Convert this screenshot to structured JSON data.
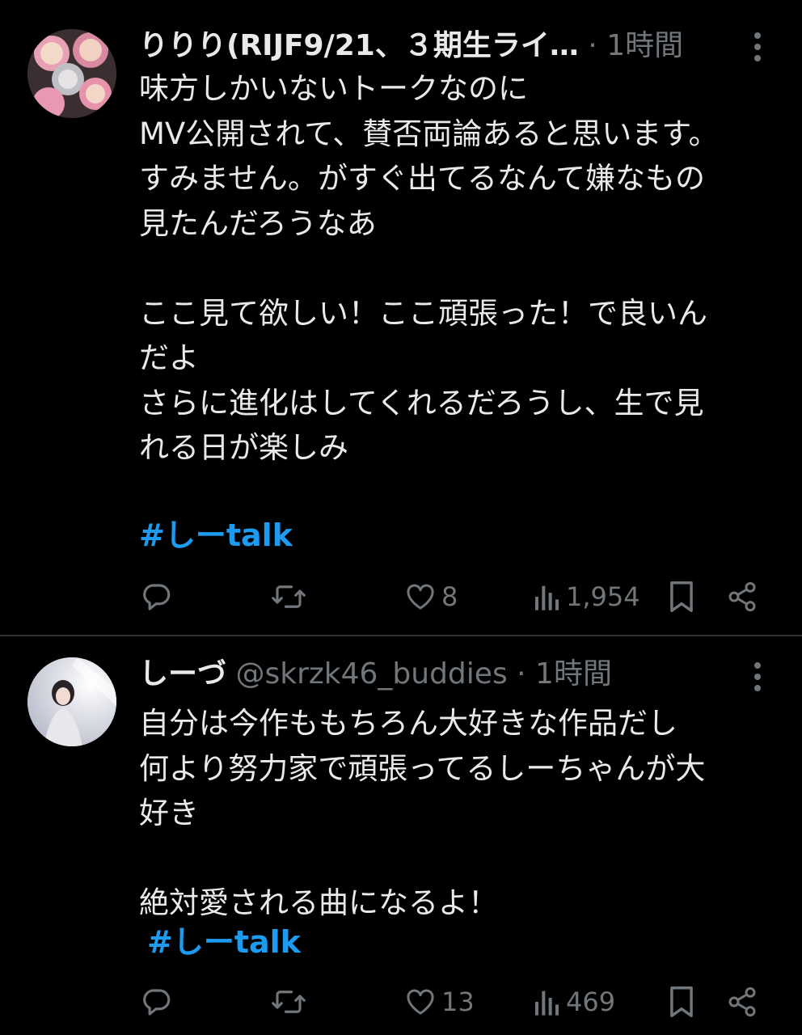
{
  "tweets": [
    {
      "name": "りりり(RIJF9/21、３期生ライ…",
      "handle": "",
      "dot": " · ",
      "time": "1時間",
      "text": "味方しかいないトークなのに\nMV公開されて、賛否両論あると思います。\nすみません。がすぐ出てるなんて嫌なもの\n見たんだろうなあ\n\nここ見て欲しい！ここ頑張った！で良いん\nだよ\nさらに進化はしてくれるだろうし、生で見\nれる日が楽しみ",
      "hashtag": "#しーtalk",
      "likes": "8",
      "views": "1,954",
      "avatar_icon": "avatar-photo-collage",
      "accent": "#1d9bf0"
    },
    {
      "name": "しーづ",
      "handle": " @skrzk46_buddies",
      "dot": " · ",
      "time": "1時間",
      "text": "自分は今作ももちろん大好きな作品だし\n何より努力家で頑張ってるしーちゃんが大\n好き\n\n絶対愛される曲になるよ！",
      "hashtag": "#しーtalk",
      "likes": "13",
      "views": "469",
      "avatar_icon": "avatar-person-photo",
      "accent": "#1d9bf0"
    }
  ],
  "icons": {
    "more": "more-vertical-icon",
    "reply": "reply-icon",
    "repost": "repost-icon",
    "like": "heart-icon",
    "views": "views-icon",
    "bookmark": "bookmark-icon",
    "share": "share-icon"
  },
  "colors": {
    "background": "#000000",
    "text": "#e7e9ea",
    "muted": "#71767b",
    "link": "#1d9bf0",
    "divider": "#2f3336"
  }
}
